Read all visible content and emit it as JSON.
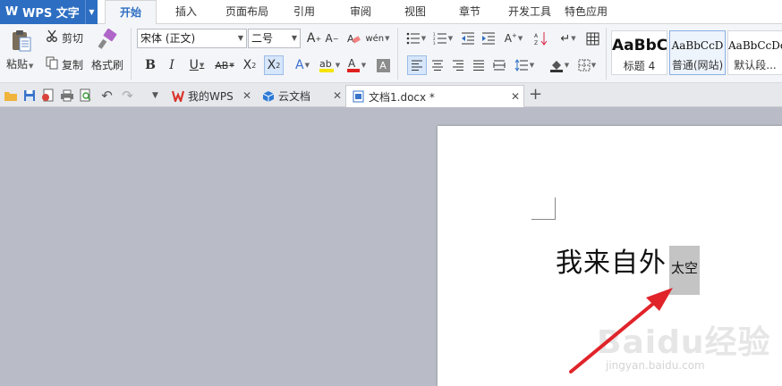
{
  "app": {
    "title": "WPS 文字"
  },
  "menu_tabs": [
    {
      "label": "开始",
      "active": true
    },
    {
      "label": "插入"
    },
    {
      "label": "页面布局"
    },
    {
      "label": "引用"
    },
    {
      "label": "审阅"
    },
    {
      "label": "视图"
    },
    {
      "label": "章节"
    },
    {
      "label": "开发工具"
    },
    {
      "label": "特色应用"
    }
  ],
  "ribbon": {
    "clipboard": {
      "paste": "粘贴",
      "cut": "剪切",
      "copy": "复制",
      "format_painter": "格式刷"
    },
    "font": {
      "name": "宋体 (正文)",
      "size": "二号"
    },
    "styles": [
      {
        "sample": "AaBbC",
        "name": "标题 4"
      },
      {
        "sample": "AaBbCcD",
        "name": "普通(网站)",
        "selected": true
      },
      {
        "sample": "AaBbCcDc",
        "name": "默认段..."
      }
    ],
    "colors": {
      "accent": "#2d6ec2",
      "highlight": "#f5e500",
      "font_color": "#e02020"
    }
  },
  "doc_tabs": [
    {
      "label": "我的WPS",
      "icon": "wps-icon"
    },
    {
      "label": "云文档",
      "icon": "cloud-doc-icon"
    },
    {
      "label": "文档1.docx *",
      "icon": "document-icon",
      "active": true
    }
  ],
  "document": {
    "main_text": "我来自外",
    "subscript_text": "太空",
    "watermark": "Baidu经验",
    "watermark_url": "jingyan.baidu.com"
  }
}
